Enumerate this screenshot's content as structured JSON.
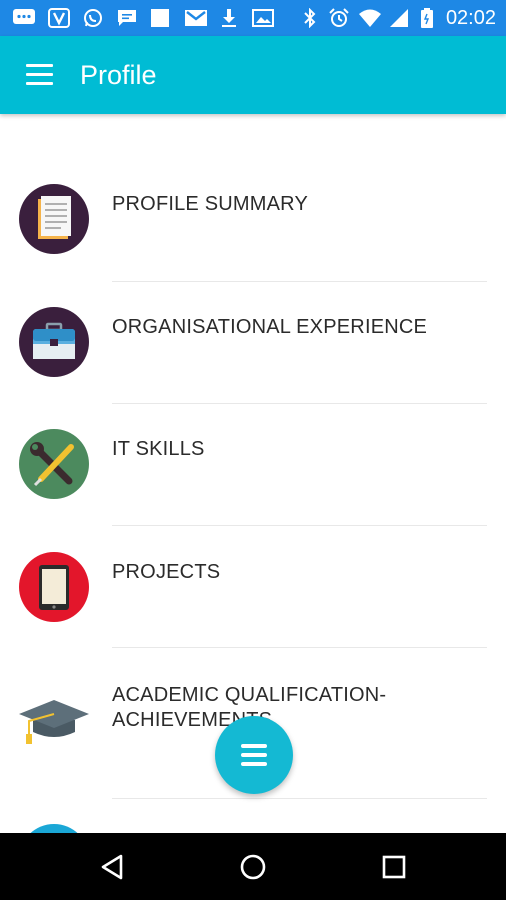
{
  "status_bar": {
    "time": "02:02",
    "icons": [
      "chat-icon",
      "v-app-icon",
      "whatsapp-icon",
      "message-icon",
      "square-icon",
      "gmail-icon",
      "download-icon",
      "image-icon",
      "bluetooth-icon",
      "alarm-icon",
      "wifi-icon",
      "signal-icon",
      "battery-icon"
    ]
  },
  "app_bar": {
    "title": "Profile",
    "menu_icon": "hamburger-menu-icon"
  },
  "items": [
    {
      "label": "PROFILE SUMMARY",
      "icon": "notepad-icon",
      "icon_bg": "#3a1f3d"
    },
    {
      "label": "ORGANISATIONAL EXPERIENCE",
      "icon": "briefcase-icon",
      "icon_bg": "#3a1f3d"
    },
    {
      "label": "IT SKILLS",
      "icon": "tools-icon",
      "icon_bg": "#4c8a5e"
    },
    {
      "label": "PROJECTS",
      "icon": "tablet-icon",
      "icon_bg": "#e3162b"
    },
    {
      "label": "ACADEMIC QUALIFICATION-\nACHIEVEMENTS",
      "icon": "graduation-cap-icon",
      "icon_bg": "#ffffff"
    }
  ],
  "fab": {
    "icon": "menu-lines-icon",
    "color": "#14b9d3"
  },
  "nav_bar": {
    "buttons": [
      "back-icon",
      "home-icon",
      "recents-icon"
    ]
  },
  "colors": {
    "status_bar": "#1e88e5",
    "app_bar": "#00bcd4",
    "text": "#2b2b2b"
  }
}
